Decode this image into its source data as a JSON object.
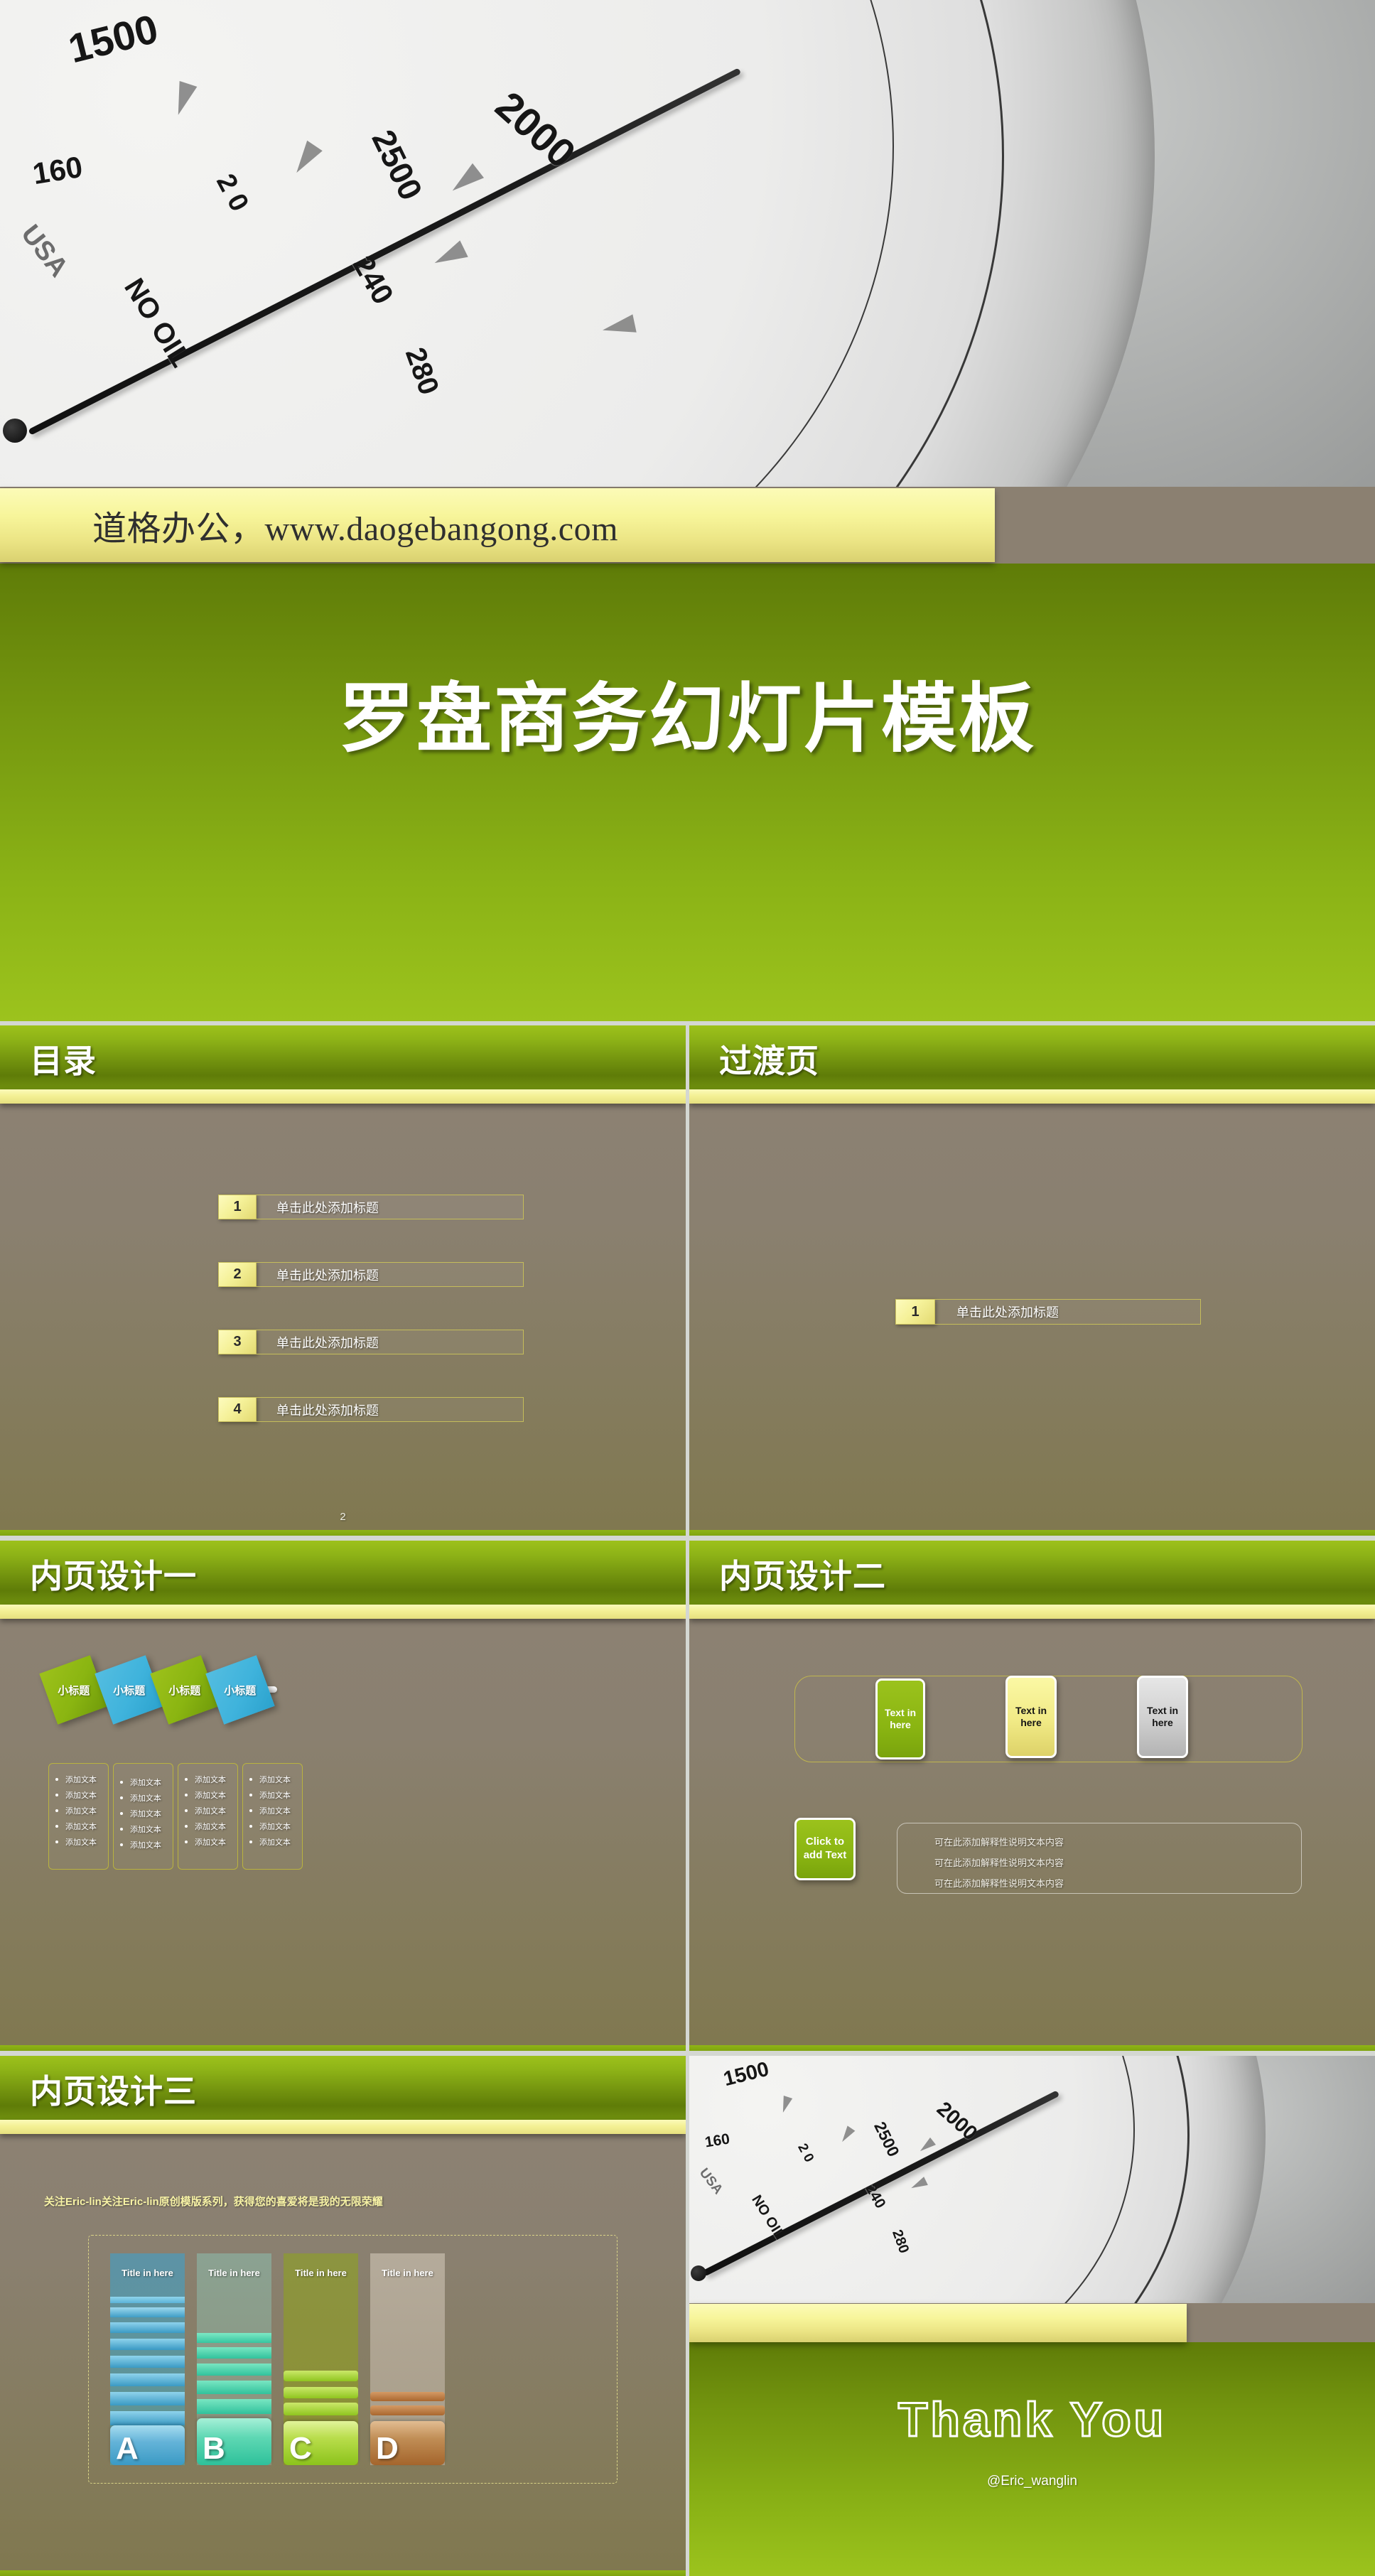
{
  "deck": {
    "cover": {
      "ribbon_text": "道格办公，www.daogebangong.com",
      "title": "罗盘商务幻灯片模板",
      "photo": {
        "name": "pressure-gauge-photo",
        "labels": [
          "1500",
          "2000",
          "2500",
          "160",
          "2 0",
          "240",
          "280",
          "USA",
          "NO OIL"
        ]
      }
    },
    "slides": [
      {
        "id": "toc",
        "title": "目录",
        "page_number": "2",
        "items": [
          {
            "num": "1",
            "label": "单击此处添加标题"
          },
          {
            "num": "2",
            "label": "单击此处添加标题"
          },
          {
            "num": "3",
            "label": "单击此处添加标题"
          },
          {
            "num": "4",
            "label": "单击此处添加标题"
          }
        ]
      },
      {
        "id": "transition",
        "title": "过渡页",
        "items": [
          {
            "num": "1",
            "label": "单击此处添加标题"
          }
        ]
      },
      {
        "id": "inner-one",
        "title": "内页设计一",
        "diamonds": [
          {
            "label": "小标题",
            "color": "green"
          },
          {
            "label": "小标题",
            "color": "blue"
          },
          {
            "label": "小标题",
            "color": "green"
          },
          {
            "label": "小标题",
            "color": "blue"
          }
        ],
        "columns": [
          {
            "items": [
              "添加文本",
              "添加文本",
              "添加文本",
              "添加文本",
              "添加文本"
            ]
          },
          {
            "items": [
              "添加文本",
              "添加文本",
              "添加文本",
              "添加文本",
              "添加文本"
            ]
          },
          {
            "items": [
              "添加文本",
              "添加文本",
              "添加文本",
              "添加文本",
              "添加文本"
            ]
          },
          {
            "items": [
              "添加文本",
              "添加文本",
              "添加文本",
              "添加文本",
              "添加文本"
            ]
          }
        ]
      },
      {
        "id": "inner-two",
        "title": "内页设计二",
        "cards": [
          {
            "label": "Text in here",
            "color": "green"
          },
          {
            "label": "Text in here",
            "color": "yellow"
          },
          {
            "label": "Text in here",
            "color": "gray"
          }
        ],
        "click_tag": "Click to add Text",
        "click_lines": [
          "可在此添加解释性说明文本内容",
          "可在此添加解释性说明文本内容",
          "可在此添加解释性说明文本内容"
        ]
      },
      {
        "id": "inner-three",
        "title": "内页设计三",
        "note": "关注Eric-lin关注Eric-lin原创模版系列，获得您的喜爱将是我的无限荣耀"
      },
      {
        "id": "closing",
        "thanks": "Thank You",
        "handle": "@Eric_wanglin"
      }
    ]
  },
  "chart_data": {
    "type": "bar",
    "title": "",
    "subtitle": "关注Eric-lin关注Eric-lin原创模版系列，获得您的喜爱将是我的无限荣耀",
    "xlabel": "",
    "ylabel": "",
    "ylim": [
      0,
      100
    ],
    "grid": false,
    "legend": "none",
    "categories": [
      "A",
      "B",
      "C",
      "D"
    ],
    "category_titles": [
      "Title in here",
      "Title in here",
      "Title in here",
      "Title in here"
    ],
    "values": [
      72,
      50,
      38,
      26
    ],
    "colors": [
      "#3d9cc0",
      "#3fc5a6",
      "#8fc31f",
      "#b5733a"
    ],
    "track_colors": [
      "#5d93a6",
      "#8ba292",
      "#8c9440",
      "#b5ab9b"
    ],
    "series": [
      {
        "name": "A",
        "stack_segments": 10,
        "filled_fraction": 0.72
      },
      {
        "name": "B",
        "stack_segments": 7,
        "filled_fraction": 0.5
      },
      {
        "name": "C",
        "stack_segments": 5,
        "filled_fraction": 0.38
      },
      {
        "name": "D",
        "stack_segments": 3,
        "filled_fraction": 0.26
      }
    ]
  }
}
